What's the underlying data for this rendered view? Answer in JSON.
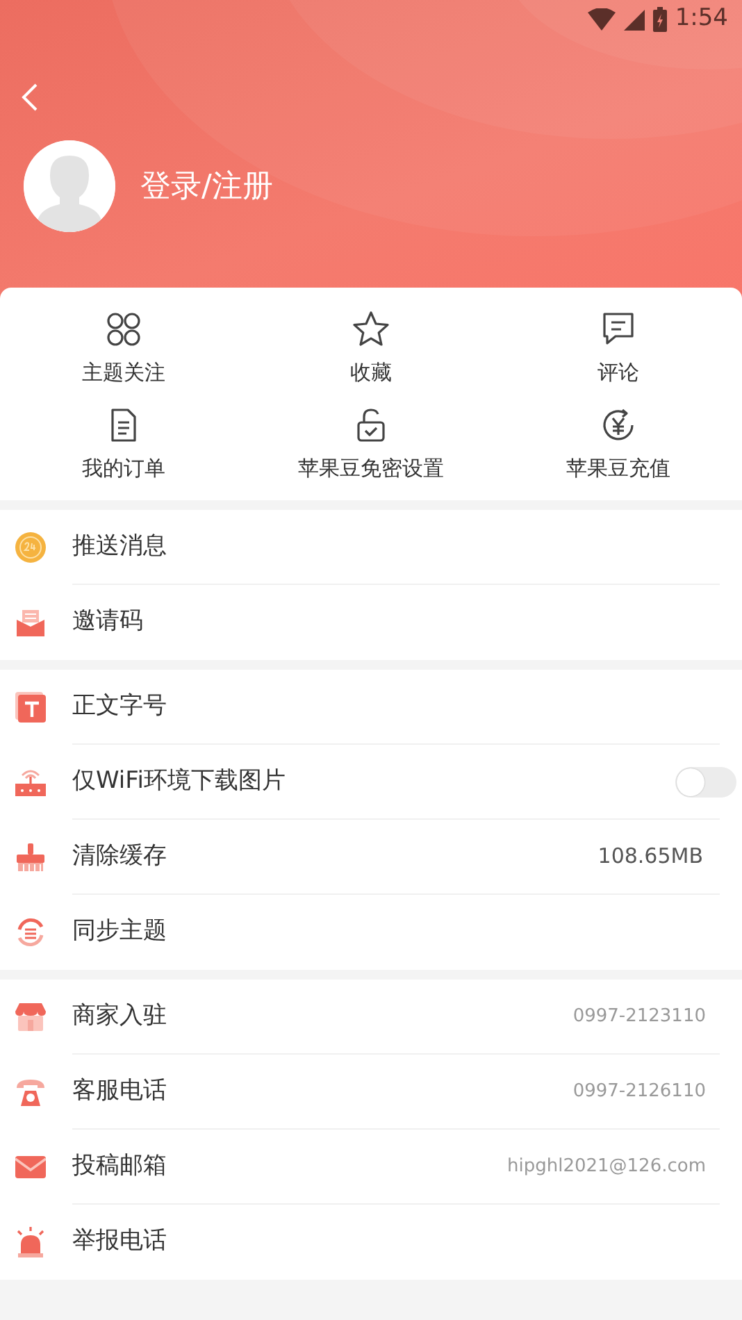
{
  "status_bar": {
    "time": "1:54"
  },
  "header": {
    "login_label": "登录/注册"
  },
  "shortcuts": [
    {
      "label": "主题关注"
    },
    {
      "label": "收藏"
    },
    {
      "label": "评论"
    },
    {
      "label": "我的订单"
    },
    {
      "label": "苹果豆免密设置"
    },
    {
      "label": "苹果豆充值"
    }
  ],
  "sections": [
    {
      "items": [
        {
          "kind": "plain",
          "label": "推送消息"
        },
        {
          "kind": "plain",
          "label": "邀请码"
        }
      ]
    },
    {
      "items": [
        {
          "kind": "plain",
          "label": "正文字号"
        },
        {
          "kind": "toggle",
          "label": "仅WiFi环境下载图片",
          "on": false
        },
        {
          "kind": "value",
          "label": "清除缓存",
          "value": "108.65MB"
        },
        {
          "kind": "plain",
          "label": "同步主题"
        }
      ]
    },
    {
      "items": [
        {
          "kind": "contact",
          "label": "商家入驻",
          "value": "0997-2123110"
        },
        {
          "kind": "contact",
          "label": "客服电话",
          "value": "0997-2126110"
        },
        {
          "kind": "contact",
          "label": "投稿邮箱",
          "value": "hipghl2021@126.com"
        },
        {
          "kind": "plain",
          "label": "举报电话"
        }
      ]
    }
  ]
}
